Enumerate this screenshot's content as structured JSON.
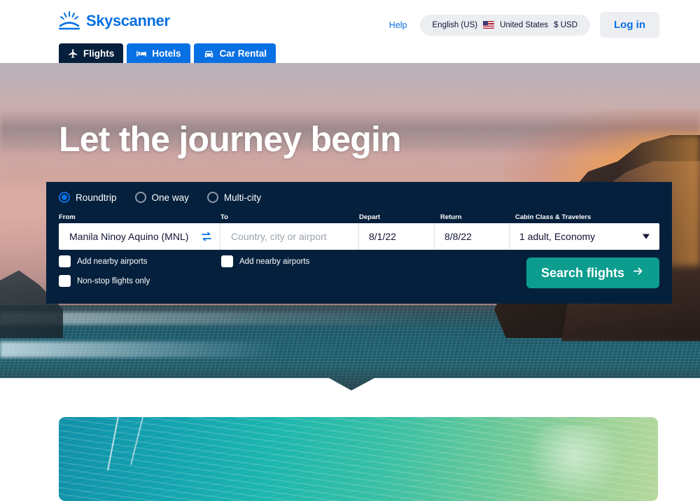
{
  "header": {
    "brand": "Skyscanner",
    "logo_icon": "sunburst-icon",
    "help_label": "Help",
    "locale": {
      "language": "English (US)",
      "flag_icon": "us-flag-icon",
      "country": "United States",
      "currency": "$ USD"
    },
    "login_label": "Log in"
  },
  "tabs": [
    {
      "label": "Flights",
      "icon": "plane-icon",
      "active": true
    },
    {
      "label": "Hotels",
      "icon": "bed-icon",
      "active": false
    },
    {
      "label": "Car Rental",
      "icon": "car-icon",
      "active": false
    }
  ],
  "hero": {
    "title": "Let the journey begin"
  },
  "search": {
    "trip_types": [
      {
        "label": "Roundtrip",
        "selected": true
      },
      {
        "label": "One way",
        "selected": false
      },
      {
        "label": "Multi-city",
        "selected": false
      }
    ],
    "labels": {
      "from": "From",
      "to": "To",
      "depart": "Depart",
      "return": "Return",
      "cabin": "Cabin Class & Travelers"
    },
    "fields": {
      "from_value": "Manila Ninoy Aquino (MNL)",
      "to_value": "",
      "to_placeholder": "Country, city or airport",
      "depart_value": "8/1/22",
      "return_value": "8/8/22",
      "cabin_value": "1 adult, Economy"
    },
    "swap_icon": "swap-arrows-icon",
    "cabin_caret_icon": "chevron-down-icon",
    "checkboxes": [
      {
        "label": "Add nearby airports",
        "checked": false
      },
      {
        "label": "Add nearby airports",
        "checked": false
      },
      {
        "label": "Non-stop flights only",
        "checked": false
      }
    ],
    "search_button": {
      "label": "Search flights",
      "icon": "arrow-right-icon"
    }
  },
  "colors": {
    "brand_blue": "#0770e3",
    "panel_navy": "#05203c",
    "search_teal": "#0c9d8e",
    "pill_grey": "#eceef1"
  }
}
